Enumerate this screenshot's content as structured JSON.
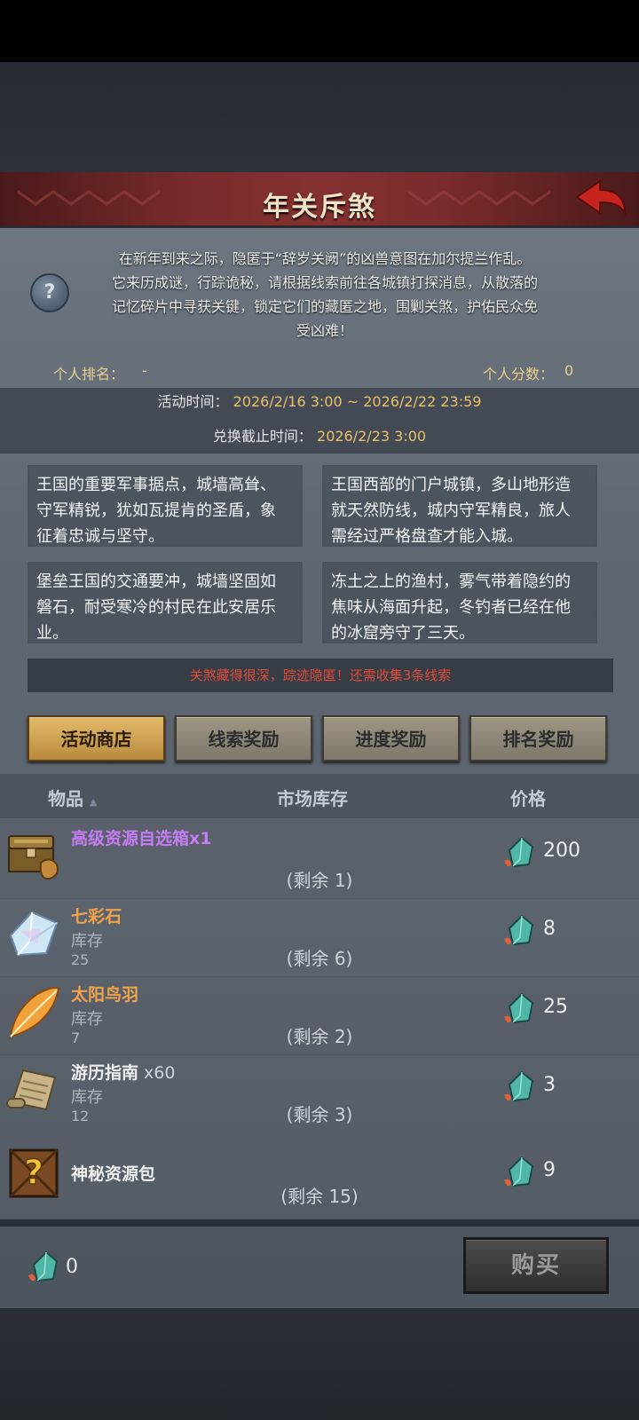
{
  "header": {
    "title": "年关斥煞"
  },
  "intro": {
    "lines": [
      "在新年到来之际，隐匿于“辞岁关阙”的凶兽意图在加尔提兰作乱。",
      "它来历成谜，行踪诡秘，请根据线索前往各城镇打探消息，从散落的",
      "记忆碎片中寻获关键，锁定它们的藏匿之地，围剿关煞，护佑民众免",
      "受凶难！"
    ]
  },
  "stats": {
    "rank_label": "个人排名：",
    "rank_value": "-",
    "score_label": "个人分数：",
    "score_value": "0"
  },
  "times": {
    "activity_label": "活动时间：",
    "activity_value": "2026/2/16 3:00 ~ 2026/2/22 23:59",
    "exchange_label": "兑换截止时间：",
    "exchange_value": "2026/2/23 3:00"
  },
  "clues": [
    [
      "王国的重要军事据点，城墙高耸、",
      "守军精锐，犹如瓦提肯的圣盾，象",
      "征着忠诚与坚守。"
    ],
    [
      "王国西部的门户城镇，多山地形造",
      "就天然防线，城内守军精良，旅人",
      "需经过严格盘查才能入城。"
    ],
    [
      "堡垒王国的交通要冲，城墙坚固如",
      "磐石，耐受寒冷的村民在此安居乐",
      "业。"
    ],
    [
      "冻土之上的渔村，雾气带着隐约的",
      "焦味从海面升起，冬钓者已经在他",
      "的冰窟旁守了三天。"
    ]
  ],
  "hint": "关煞藏得很深，踪迹隐匿！还需收集3条线索",
  "tabs": [
    "活动商店",
    "线索奖励",
    "进度奖励",
    "排名奖励"
  ],
  "columns": {
    "item": "物品",
    "item_sort": "▲",
    "stock": "市场库存",
    "price": "价格"
  },
  "items": [
    {
      "name": "高级资源自选箱",
      "qty": "x1",
      "name_color": "#c47cf2",
      "stock_label": "",
      "stock_value": "",
      "remaining": "(剩余 1)",
      "price": "200",
      "icon": "treasure-chest-icon"
    },
    {
      "name": "七彩石",
      "qty": "",
      "name_color": "#f0a24a",
      "stock_label": "库存",
      "stock_value": "25",
      "remaining": "(剩余 6)",
      "price": "8",
      "icon": "rainbow-crystal-icon"
    },
    {
      "name": "太阳鸟羽",
      "qty": "",
      "name_color": "#f0a24a",
      "stock_label": "库存",
      "stock_value": "7",
      "remaining": "(剩余 2)",
      "price": "25",
      "icon": "sunbird-feather-icon"
    },
    {
      "name": "游历指南",
      "qty": " x60",
      "name_color": "#eeeeee",
      "stock_label": "库存",
      "stock_value": "12",
      "remaining": "(剩余 3)",
      "price": "3",
      "icon": "scroll-icon"
    },
    {
      "name": "神秘资源包",
      "qty": "",
      "name_color": "#eeeeee",
      "stock_label": "",
      "stock_value": "",
      "remaining": "(剩余 15)",
      "price": "9",
      "icon": "mystery-crate-icon"
    }
  ],
  "footer": {
    "currency_value": "0",
    "buy_label": "购买"
  },
  "colors": {
    "accent_gold": "#e9c06a",
    "hint_red": "#e04a3a",
    "header_red": "#843030"
  }
}
